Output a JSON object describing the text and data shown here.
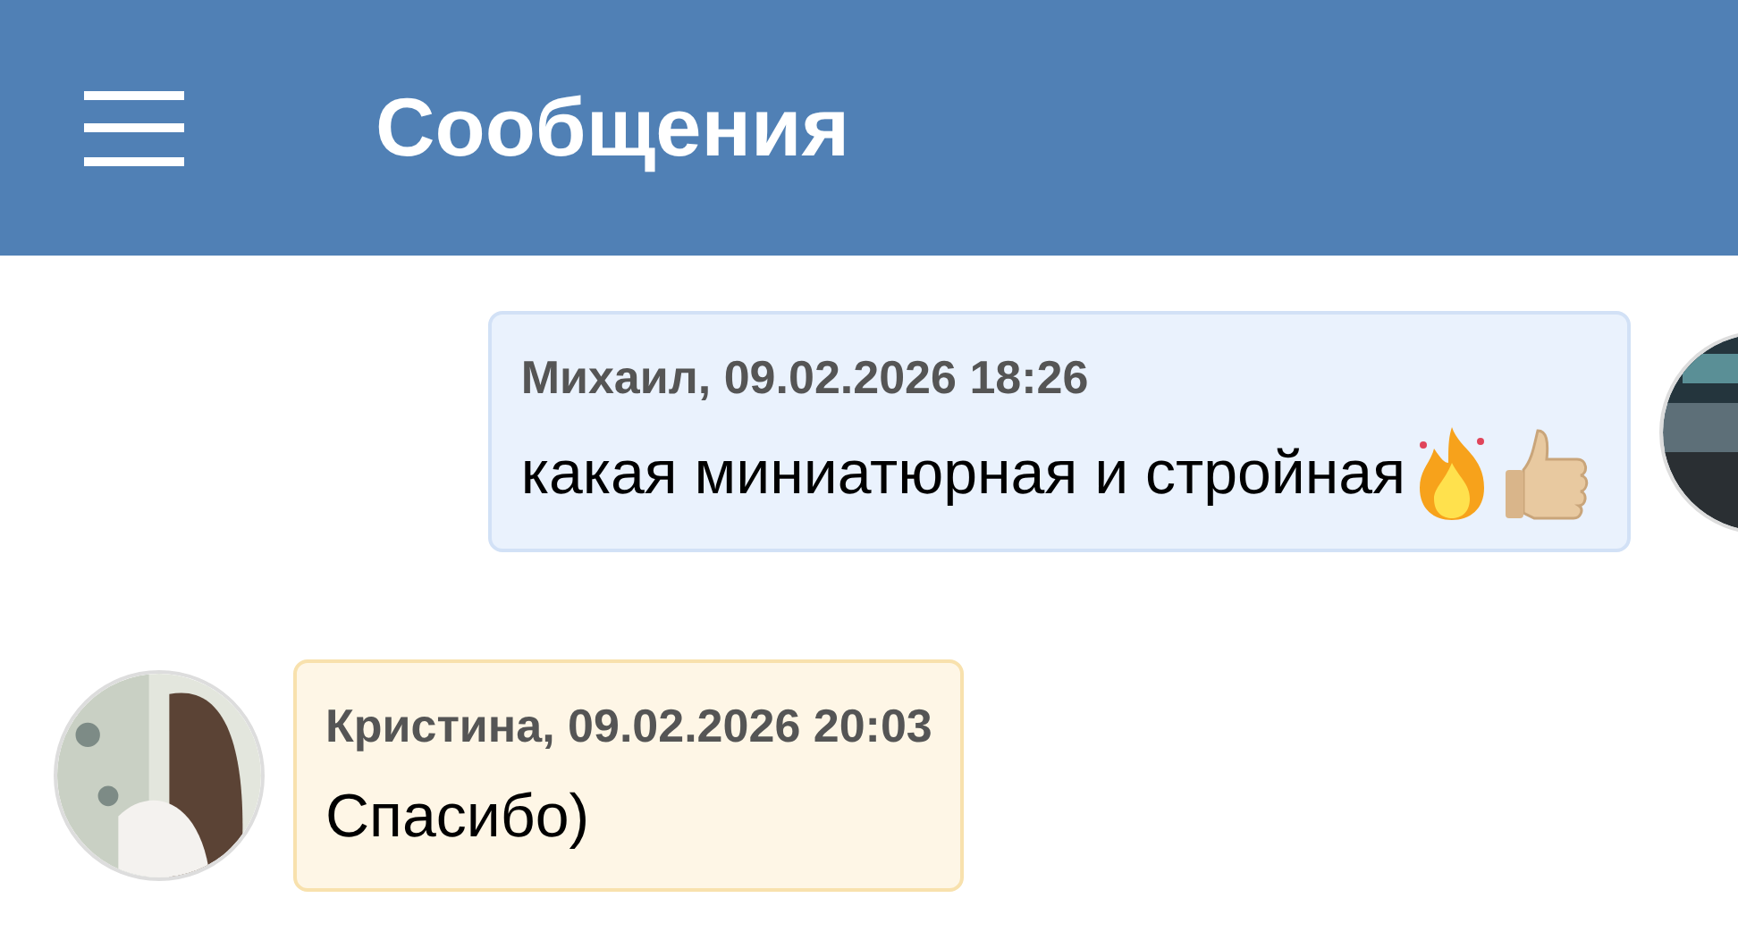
{
  "header": {
    "title": "Сообщения"
  },
  "messages": [
    {
      "kind": "outgoing",
      "author": "Михаил, 09.02.2026 18:26",
      "text": "какая миниатюрная и стройная",
      "trailing_emoji": true
    },
    {
      "kind": "incoming",
      "author": "Кристина, 09.02.2026 20:03",
      "text": "Спасибо)",
      "trailing_emoji": false
    }
  ]
}
